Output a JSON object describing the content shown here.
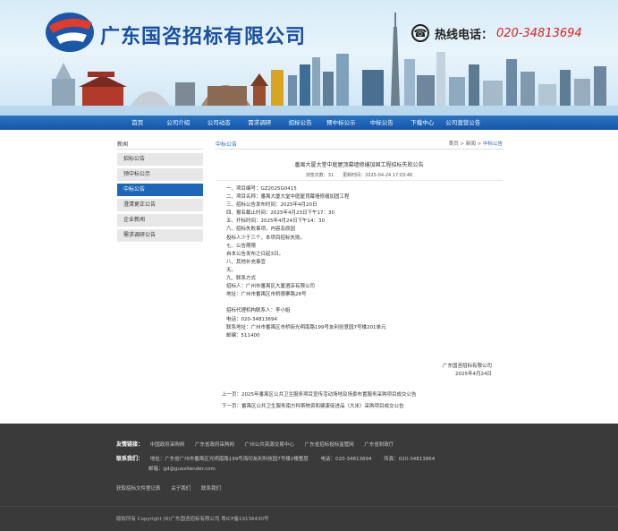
{
  "header": {
    "company_name": "广东国咨招标有限公司",
    "hotline_label": "热线电话：",
    "hotline_number": "020-34813694"
  },
  "nav": [
    "首页",
    "公司介绍",
    "公司动态",
    "需求调研",
    "招标公告",
    "预中标公示",
    "中标公告",
    "下载中心",
    "公司渡营公告"
  ],
  "sidebar": {
    "title": "新闻",
    "items": [
      {
        "label": "招标公告",
        "active": false
      },
      {
        "label": "预中标公示",
        "active": false
      },
      {
        "label": "中标公告",
        "active": true
      },
      {
        "label": "澄清更正公告",
        "active": false
      },
      {
        "label": "企业新闻",
        "active": false
      },
      {
        "label": "需求调研公告",
        "active": false
      }
    ]
  },
  "main": {
    "section_title": "中标公告",
    "breadcrumb": {
      "home": "首页",
      "sep": " > ",
      "parent": "新闻",
      "current": "中标公告"
    },
    "article": {
      "title": "番禺大厦大堂中庭屋顶幕墙修缮加固工程招标失败公告",
      "meta": "浏览次数：31　　更新时间：2025-04-24 17:03:46",
      "lines": [
        "一、项目编号：GZ2025G0415",
        "二、项目名称：番禺大厦大堂中庭屋顶幕墙修缮加固工程",
        "三、招标公告发布时间：2025年4月20日",
        "四、报名截止时间：2025年4月23日下午17：30",
        "五、开标时间：2025年4月24日下午14：30",
        "六、招标失败事项，内容及原因",
        "投标人少于三个，本项目招标失败。",
        "七、公告期限",
        "自本公告发布之日起3日。",
        "八、其他补充事宜",
        "无。",
        "九、联系方式",
        "招标人：广州市番禺区大厦酒店有限公司",
        "地址：广州市番禺区市桥德寨路28号",
        "",
        "招标代理机构联系人：李小姐",
        "电话：020-34813694",
        "联系地址：广州市番禺区市桥街光明南路199号友利创意园7号楼201单元",
        "邮编：511400"
      ],
      "sign_company": "广东国咨招标有限公司",
      "sign_date": "2025年4月24日"
    },
    "prev_label": "上一页：",
    "prev_title": "2025年番禺区公共卫生服务项目宣传活动场地及场景布置服务采购项目成交公告",
    "next_label": "下一页：",
    "next_title": "番禺区公共卫生服务南方科斯物资和健康促进品（大米）采购项目成交公告"
  },
  "footer": {
    "links_label": "友情链接：",
    "links": [
      "中国政府采购网",
      "广东省政府采购网",
      "广州公共资源交易中心",
      "广东省招标投标监管网",
      "广东省财政厅"
    ],
    "contact_label": "联系我们：",
    "address": "地址：广东省广州市番禺区光明南路199号海印友利科技园7号楼2楼整层",
    "phone": "电话：020-34813694",
    "fax": "传真：020-34813864",
    "email": "邮箱：gd@guozitender.com",
    "bottom_links": [
      "获取招标文件登记表",
      "关于我们",
      "联系我们"
    ],
    "copyright": "版权所有 Copyright (R)广东国咨招标有限公司 粤ICP备19136430号"
  },
  "colors": {
    "brand": "#1a4fa0",
    "nav": "#1e66b8",
    "hotline": "#e02020",
    "footer": "#3a3a3a"
  }
}
